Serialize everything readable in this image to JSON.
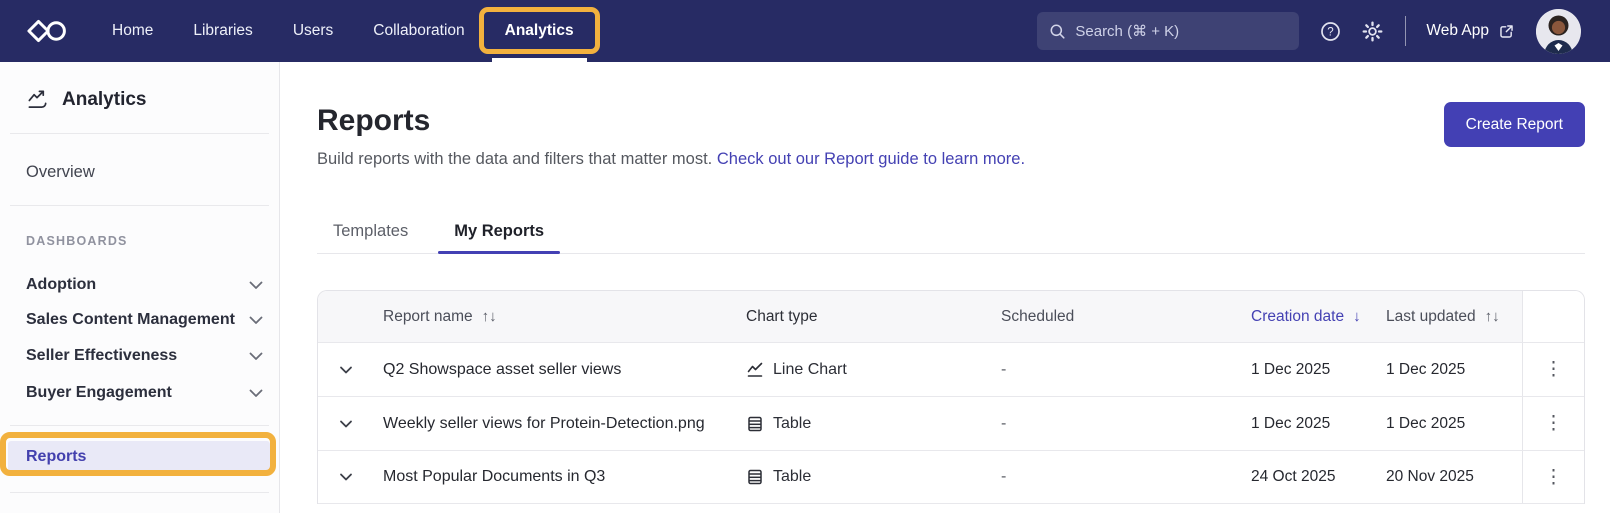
{
  "topnav": {
    "brand": "Showpad",
    "items": [
      {
        "label": "Home"
      },
      {
        "label": "Libraries"
      },
      {
        "label": "Users"
      },
      {
        "label": "Collaboration"
      },
      {
        "label": "Analytics",
        "active": true
      }
    ],
    "search": {
      "placeholder": "Search (⌘ + K)"
    },
    "web_app_label": "Web App"
  },
  "sidebar": {
    "title": "Analytics",
    "overview_label": "Overview",
    "section_label": "DASHBOARDS",
    "dashboards": [
      "Adoption",
      "Sales Content Management",
      "Seller Effectiveness",
      "Buyer Engagement"
    ],
    "reports_label": "Reports"
  },
  "main": {
    "title": "Reports",
    "description": "Build reports with the data and filters that matter most.",
    "description_link": "Check out our Report guide to learn more.",
    "create_button_label": "Create Report",
    "tabs": [
      {
        "label": "Templates",
        "active": false
      },
      {
        "label": "My Reports",
        "active": true
      }
    ],
    "table": {
      "columns": [
        {
          "label": "Report name",
          "sort_icon": "↑↓",
          "sorted": false
        },
        {
          "label": "Chart type",
          "sort_icon": "",
          "sorted": false
        },
        {
          "label": "Scheduled",
          "sort_icon": "",
          "sorted": false
        },
        {
          "label": "Creation date",
          "sort_icon": "↓",
          "sorted": true
        },
        {
          "label": "Last updated",
          "sort_icon": "↑↓",
          "sorted": false
        }
      ],
      "rows": [
        {
          "name": "Q2 Showspace asset seller views",
          "chart_icon": "line-chart-icon",
          "chart_type": "Line Chart",
          "scheduled": "-",
          "creation_date": "1 Dec 2025",
          "last_updated": "1 Dec 2025",
          "actions_icon": "⋮"
        },
        {
          "name": "Weekly seller views for Protein-Detection.png",
          "chart_icon": "table-icon",
          "chart_type": "Table",
          "scheduled": "-",
          "creation_date": "1 Dec 2025",
          "last_updated": "1 Dec 2025",
          "actions_icon": "⋮"
        },
        {
          "name": "Most Popular Documents in Q3",
          "chart_icon": "table-icon",
          "chart_type": "Table",
          "scheduled": "-",
          "creation_date": "24 Oct 2025",
          "last_updated": "20 Nov 2025",
          "actions_icon": "⋮"
        }
      ]
    }
  },
  "annotations": {
    "highlight_color": "#F2B13E",
    "highlighted_elements": [
      "Analytics nav item",
      "Reports sidebar item"
    ]
  },
  "colors": {
    "navbar": "#272B64",
    "accent": "#4340B4",
    "selected_bg": "#E9E9F7",
    "header_bg": "#F7F7F9",
    "border": "#E4E4E9"
  }
}
